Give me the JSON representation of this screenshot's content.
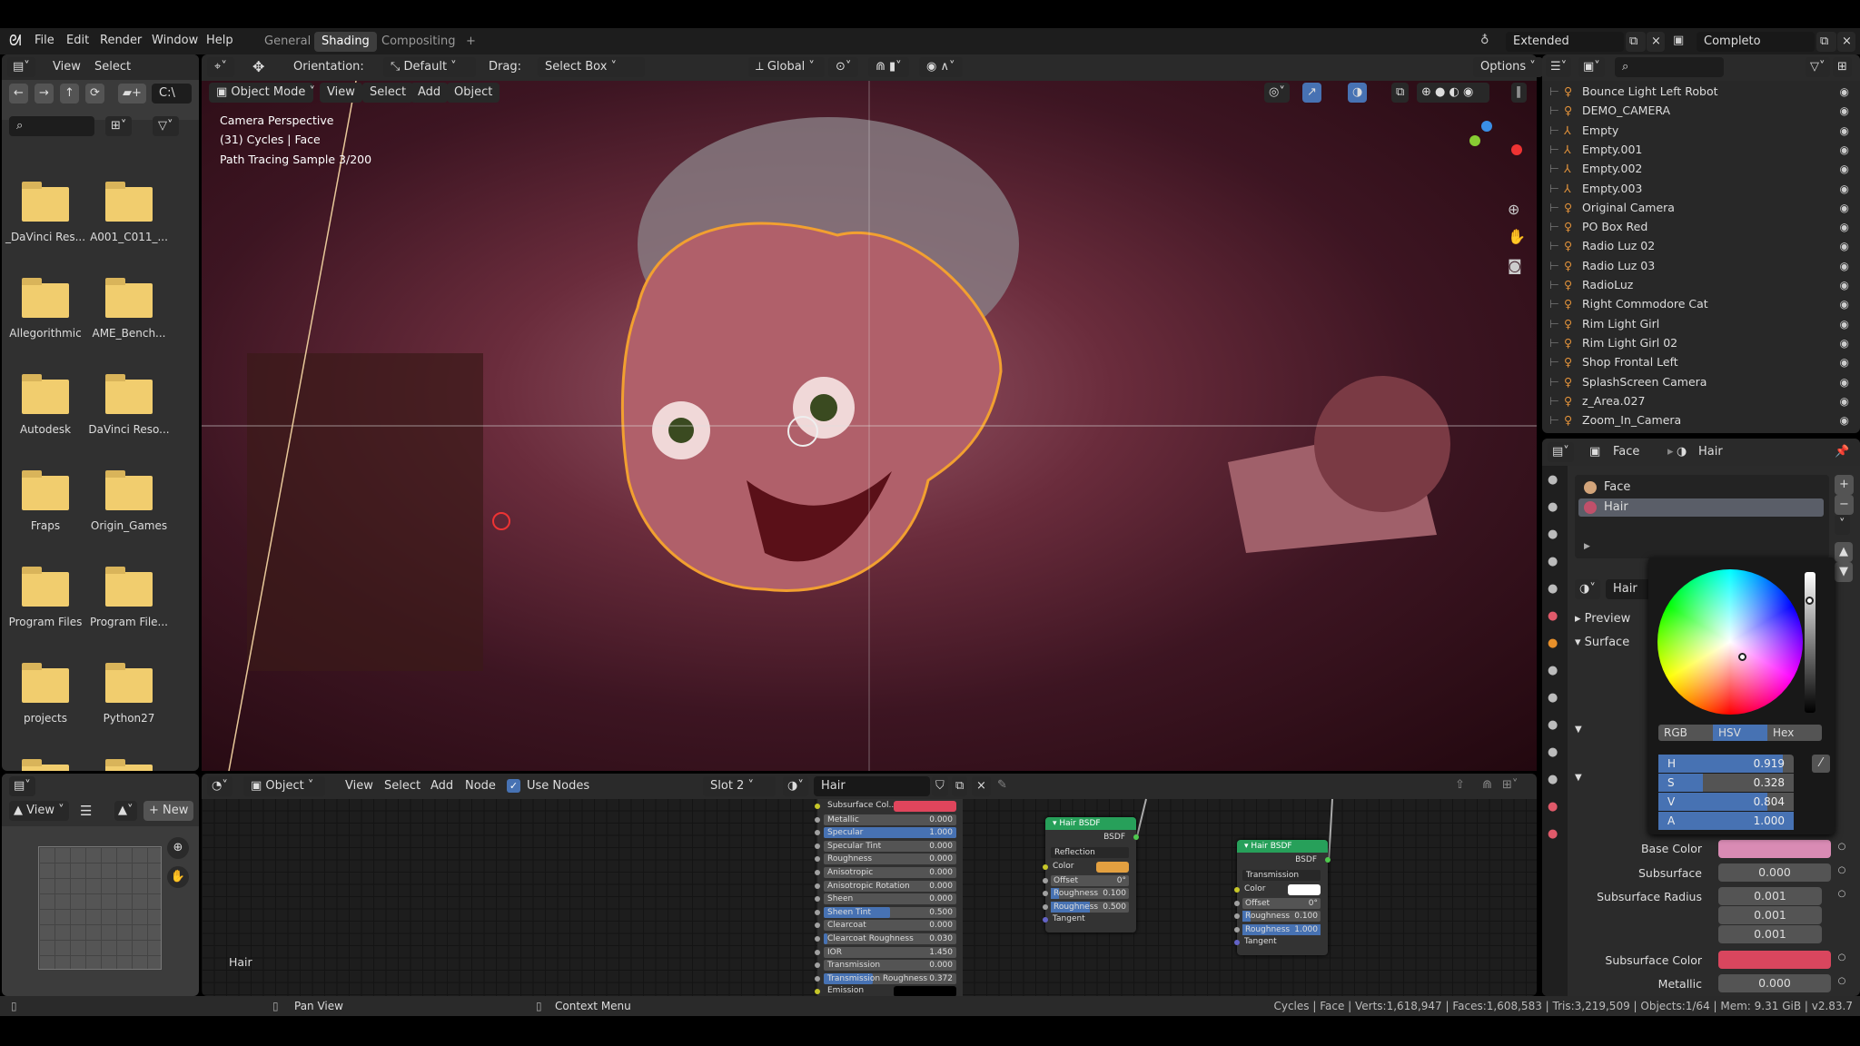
{
  "topbar": {
    "menus": [
      "File",
      "Edit",
      "Render",
      "Window",
      "Help"
    ],
    "tabs": [
      "General",
      "Shading",
      "Compositing"
    ],
    "active_tab": "Shading",
    "add_tab": "+",
    "scene": "Extended",
    "view_layer": "Completo"
  },
  "file_browser": {
    "header": {
      "view": "View",
      "select": "Select"
    },
    "path": "C:\\",
    "folders": [
      "_DaVinci Res...",
      "A001_C011_...",
      "Allegorithmic",
      "AME_Bench...",
      "Autodesk",
      "DaVinci Reso...",
      "Fraps",
      "Origin_Games",
      "Program Files",
      "Program File...",
      "projects",
      "Python27",
      "",
      ""
    ]
  },
  "viewport": {
    "header": {
      "orientation_label": "Orientation:",
      "orientation": "Default",
      "drag_label": "Drag:",
      "drag": "Select Box",
      "transform": "Global",
      "options": "Options"
    },
    "subheader": {
      "mode": "Object Mode",
      "view": "View",
      "select": "Select",
      "add": "Add",
      "object": "Object"
    },
    "overlay": [
      "Camera Perspective",
      "(31) Cycles | Face",
      "Path Tracing Sample 3/200"
    ]
  },
  "outliner": {
    "items": [
      "Bounce Light Left Robot",
      "DEMO_CAMERA",
      "Empty",
      "Empty.001",
      "Empty.002",
      "Empty.003",
      "Original Camera",
      "PO Box Red",
      "Radio Luz 02",
      "Radio Luz 03",
      "RadioLuz",
      "Right Commodore Cat",
      "Rim Light Girl",
      "Rim Light Girl 02",
      "Shop Frontal Left",
      "SplashScreen Camera",
      "z_Area.027",
      "Zoom_In_Camera"
    ]
  },
  "properties": {
    "breadcrumb": [
      "Face",
      "Hair"
    ],
    "slots": [
      "Face",
      "Hair"
    ],
    "active_slot": "Hair",
    "material": "Hair",
    "panels": {
      "preview": "Preview",
      "surface": "Surface"
    },
    "fields": {
      "base_color_label": "Base Color",
      "base_color": "#d98bb4",
      "subsurface_label": "Subsurface",
      "subsurface": "0.000",
      "radius_label": "Subsurface Radius",
      "radius": [
        "0.001",
        "0.001",
        "0.001"
      ],
      "subsurface_color_label": "Subsurface Color",
      "subsurface_color": "#d9465e",
      "metallic_label": "Metallic",
      "metallic": "0.000"
    }
  },
  "color_picker": {
    "modes": [
      "RGB",
      "HSV",
      "Hex"
    ],
    "active_mode": "HSV",
    "h": {
      "label": "H",
      "value": "0.919",
      "fill": 0.919
    },
    "s": {
      "label": "S",
      "value": "0.328",
      "fill": 0.328
    },
    "v": {
      "label": "V",
      "value": "0.804",
      "fill": 0.804
    },
    "a": {
      "label": "A",
      "value": "1.000",
      "fill": 1.0
    }
  },
  "node_editor": {
    "header": {
      "type": "Object",
      "view": "View",
      "select": "Select",
      "add": "Add",
      "node": "Node",
      "use_nodes": "Use Nodes",
      "use_nodes_checked": true,
      "slot": "Slot 2",
      "material": "Hair"
    },
    "frame_label": "Hair",
    "principled_rows": [
      {
        "label": "Subsurface Col...",
        "color": "#e0455c"
      },
      {
        "label": "Metallic",
        "value": "0.000",
        "fill": 0
      },
      {
        "label": "Specular",
        "value": "1.000",
        "fill": 1
      },
      {
        "label": "Specular Tint",
        "value": "0.000",
        "fill": 0
      },
      {
        "label": "Roughness",
        "value": "0.000",
        "fill": 0
      },
      {
        "label": "Anisotropic",
        "value": "0.000",
        "fill": 0
      },
      {
        "label": "Anisotropic Rotation",
        "value": "0.000",
        "fill": 0
      },
      {
        "label": "Sheen",
        "value": "0.000",
        "fill": 0
      },
      {
        "label": "Sheen Tint",
        "value": "0.500",
        "fill": 0.5
      },
      {
        "label": "Clearcoat",
        "value": "0.000",
        "fill": 0
      },
      {
        "label": "Clearcoat Roughness",
        "value": "0.030",
        "fill": 0.03
      },
      {
        "label": "IOR",
        "value": "1.450",
        "fill": 0
      },
      {
        "label": "Transmission",
        "value": "0.000",
        "fill": 0
      },
      {
        "label": "Transmission Roughness",
        "value": "0.372",
        "fill": 0.372
      },
      {
        "label": "Emission",
        "color": "#000000"
      }
    ],
    "hair_nodes": [
      {
        "title": "Hair BSDF",
        "output": "BSDF",
        "component": "Reflection",
        "color_label": "Color",
        "color": "#e3a040",
        "offset_label": "Offset",
        "offset": "0°",
        "r1_label": "Roughness",
        "r1": "0.100",
        "r1_fill": 0.1,
        "r2_label": "Roughness",
        "r2": "0.500",
        "r2_fill": 0.5,
        "tangent": "Tangent"
      },
      {
        "title": "Hair BSDF",
        "output": "BSDF",
        "component": "Transmission",
        "color_label": "Color",
        "color": "#ffffff",
        "offset_label": "Offset",
        "offset": "0°",
        "r1_label": "Roughness",
        "r1": "0.100",
        "r1_fill": 0.1,
        "r2_label": "Roughness",
        "r2": "1.000",
        "r2_fill": 1.0,
        "tangent": "Tangent"
      }
    ]
  },
  "image_editor": {
    "view": "View",
    "new": "New"
  },
  "statusbar": {
    "pan": "Pan View",
    "context": "Context Menu",
    "stats": "Cycles | Face | Verts:1,618,947 | Faces:1,608,583 | Tris:3,219,509 | Objects:1/64 | Mem: 9.31 GiB | v2.83.7"
  }
}
